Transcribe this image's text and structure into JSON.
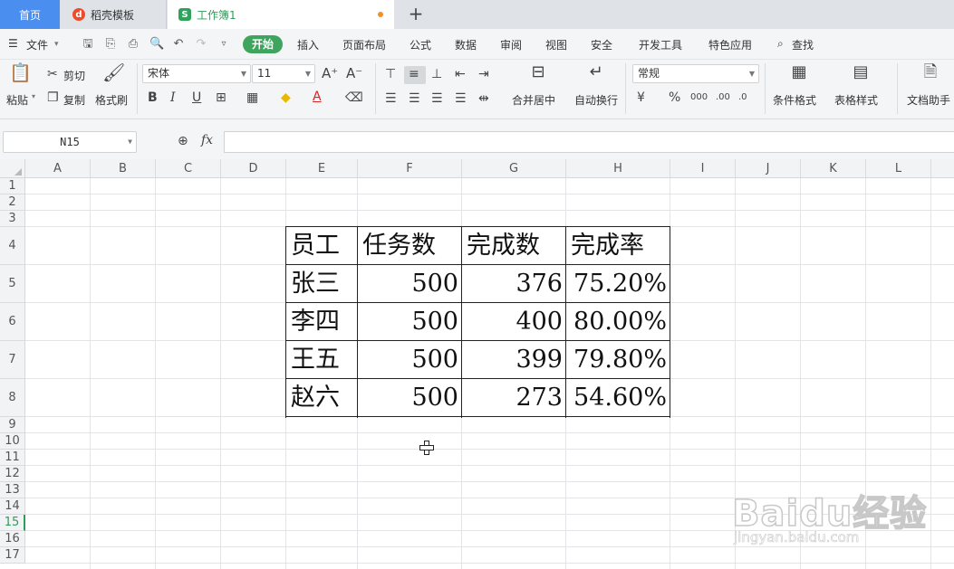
{
  "tabs": [
    {
      "label": "首页"
    },
    {
      "label": "稻壳模板"
    },
    {
      "label": "工作簿1"
    }
  ],
  "menu": {
    "file": "文件",
    "items": [
      "开始",
      "插入",
      "页面布局",
      "公式",
      "数据",
      "审阅",
      "视图",
      "安全",
      "开发工具",
      "特色应用"
    ],
    "search": "查找"
  },
  "ribbon": {
    "paste": "粘贴",
    "cut": "剪切",
    "copy": "复制",
    "format_painter": "格式刷",
    "font_name": "宋体",
    "font_size": "11",
    "bold": "B",
    "italic": "I",
    "underline": "U",
    "merge_center": "合并居中",
    "wrap_text": "自动换行",
    "number_format": "常规",
    "conditional_format": "条件格式",
    "table_style": "表格样式",
    "doc_assistant": "文档助手"
  },
  "formula_bar": {
    "name_box": "N15",
    "fx": "fx",
    "value": ""
  },
  "grid": {
    "columns": [
      "A",
      "B",
      "C",
      "D",
      "E",
      "F",
      "G",
      "H",
      "I",
      "J",
      "K",
      "L"
    ],
    "rows": [
      "1",
      "2",
      "3",
      "4",
      "5",
      "6",
      "7",
      "8",
      "9",
      "10",
      "11",
      "12",
      "13",
      "14",
      "15",
      "16",
      "17"
    ],
    "selected_row": "15",
    "table": {
      "headers": [
        "员工",
        "任务数",
        "完成数",
        "完成率"
      ],
      "rows": [
        [
          "张三",
          "500",
          "376",
          "75.20%"
        ],
        [
          "李四",
          "500",
          "400",
          "80.00%"
        ],
        [
          "王五",
          "500",
          "399",
          "79.80%"
        ],
        [
          "赵六",
          "500",
          "273",
          "54.60%"
        ]
      ]
    }
  },
  "watermark": {
    "logo": "Baidu经验",
    "sub": "jingyan.baidu.com"
  }
}
